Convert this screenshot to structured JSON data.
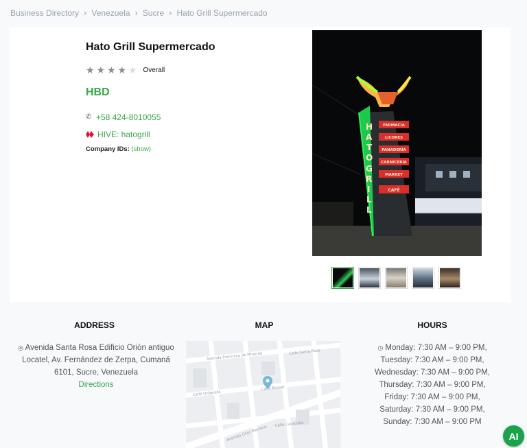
{
  "breadcrumb": [
    "Business Directory",
    "Venezuela",
    "Sucre",
    "Hato Grill Supermercado"
  ],
  "business": {
    "name": "Hato Grill Supermercado",
    "rating_label": "Overall",
    "stars_filled": 4,
    "stars_total": 5,
    "currency": "HBD",
    "phone": "+58 424-8010055",
    "hive": "HIVE: hatogrill",
    "company_ids_label": "Company IDs:",
    "company_ids_link": "(show)"
  },
  "sections": {
    "address_title": "ADDRESS",
    "map_title": "MAP",
    "hours_title": "HOURS"
  },
  "address": {
    "lines": [
      "Avenida Santa Rosa Edificio Orión antiguo",
      "Locatel, Av. Fernández de Zerpa, Cumaná",
      "6101, Sucre, Venezuela"
    ],
    "directions": "Directions"
  },
  "hours": [
    "Monday: 7:30 AM – 9:00 PM,",
    "Tuesday: 7:30 AM – 9:00 PM,",
    "Wednesday: 7:30 AM – 9:00 PM,",
    "Thursday: 7:30 AM – 9:00 PM,",
    "Friday: 7:30 AM – 9:00 PM,",
    "Saturday: 7:30 AM – 9:00 PM,",
    "Sunday: 7:30 AM – 9:00 PM"
  ],
  "map_labels": [
    "Calle Santa Rosa",
    "Calle Bolivar",
    "Avenida Gran Mariscal",
    "Calle Carabobo",
    "Calle Urdaneta",
    "Avenida Francisco de Miranda"
  ],
  "photo_sign": {
    "vertical": "HATOGRILL",
    "items": [
      "FARMACIA",
      "LICORES",
      "PANADERÍA",
      "CARNICERÍA",
      "MARKET",
      "CAFÉ"
    ]
  },
  "ai_button": "AI",
  "colors": {
    "accent": "#3aa54a",
    "ai": "#1aa34a"
  }
}
